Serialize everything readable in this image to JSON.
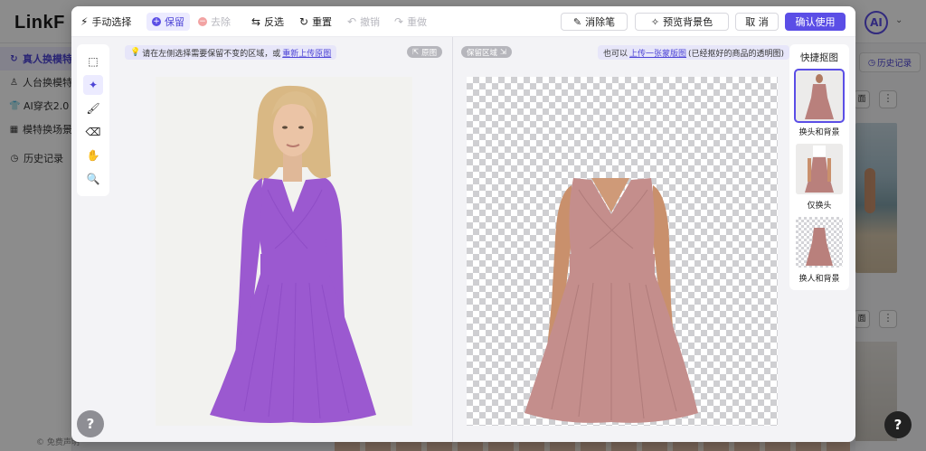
{
  "app": {
    "logo": "LinkF",
    "avatar": "AI",
    "footer": "© 免费声明",
    "history_button": "历史记录",
    "nav": [
      {
        "label": "真人换模特",
        "icon": "↻",
        "active": true
      },
      {
        "label": "人台换模特",
        "icon": "♙",
        "active": false
      },
      {
        "label": "AI穿衣2.0",
        "icon": "👕",
        "active": false
      },
      {
        "label": "模特换场景",
        "icon": "▦",
        "active": false
      },
      {
        "label": "历史记录",
        "icon": "◷",
        "active": false
      }
    ],
    "more_button": "⋮",
    "chip_label": "面"
  },
  "toolbar": {
    "manual_select": "手动选择",
    "keep": "保留",
    "remove": "去除",
    "invert": "反选",
    "reset": "重置",
    "undo": "撤销",
    "redo": "重做",
    "eraser": "消除笔",
    "preview_bg": "预览背景色",
    "cancel": "取 消",
    "confirm": "确认使用"
  },
  "tools": [
    {
      "name": "smart-select-tool-icon",
      "glyph": "⬚",
      "active": false
    },
    {
      "name": "magic-wand-tool-icon",
      "glyph": "✦",
      "active": true
    },
    {
      "name": "brush-tool-icon",
      "glyph": "🖌",
      "active": false
    },
    {
      "name": "eraser-tool-icon",
      "glyph": "⌫",
      "active": false
    },
    {
      "name": "hand-tool-icon",
      "glyph": "✋",
      "active": false
    },
    {
      "name": "zoom-tool-icon",
      "glyph": "🔍",
      "active": false
    }
  ],
  "left": {
    "hint_text": "请在左侧选择需要保留不变的区域，或",
    "hint_link": "重新上传原图",
    "pill": "原图",
    "mask_color": "#9b59d0"
  },
  "right": {
    "pill": "保留区域",
    "hint_prefix": "也可以",
    "hint_link": "上传一张蒙版图",
    "hint_suffix": "(已经抠好的商品的透明图)",
    "dress_color": "#c48e8c"
  },
  "quick": {
    "title": "快捷抠图",
    "items": [
      {
        "label": "换头和背景",
        "selected": true,
        "checker": false
      },
      {
        "label": "仅换头",
        "selected": false,
        "checker": false
      },
      {
        "label": "换人和背景",
        "selected": false,
        "checker": true
      }
    ]
  },
  "help": "?",
  "colors": {
    "accent": "#5b4ee6",
    "accent_light": "#ecebff"
  }
}
